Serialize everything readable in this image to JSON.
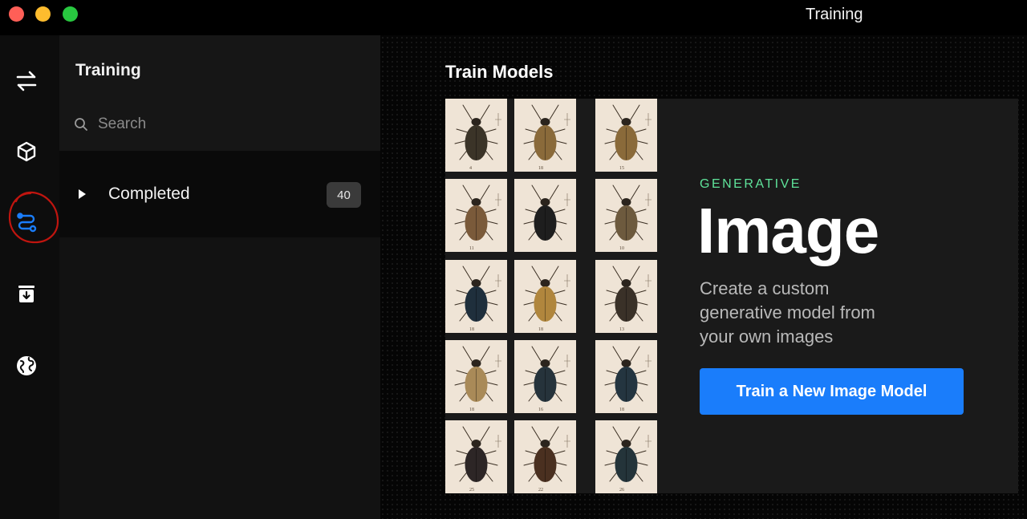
{
  "window": {
    "title": "Training"
  },
  "rail": {
    "items": [
      {
        "name": "swap-icon"
      },
      {
        "name": "cube-icon"
      },
      {
        "name": "workflow-icon",
        "active": true
      },
      {
        "name": "download-box-icon"
      },
      {
        "name": "globe-icon"
      }
    ],
    "accent": "#1a7dfb",
    "annotation_color": "#c0150f"
  },
  "sidebar": {
    "title": "Training",
    "search": {
      "placeholder": "Search",
      "value": ""
    },
    "groups": [
      {
        "label": "Completed",
        "count": "40",
        "expanded": false
      }
    ]
  },
  "main": {
    "title": "Train Models",
    "card": {
      "eyebrow": "GENERATIVE",
      "headline": "Image",
      "description": "Create a custom generative model from your own images",
      "button_label": "Train a New Image Model",
      "button_color": "#1a7dfb",
      "eyebrow_color": "#5fe39a"
    },
    "gallery": {
      "rows": 5,
      "cols": 3,
      "beetles": [
        {
          "color": "#3b3428",
          "label": "4"
        },
        {
          "color": "#8a6a3a",
          "label": "18"
        },
        {
          "color": "#8a6a3a",
          "label": "15"
        },
        {
          "color": "#7a5a3a",
          "label": "11"
        },
        {
          "color": "#1e1e1e",
          "label": ""
        },
        {
          "color": "#6d5a3e",
          "label": "10"
        },
        {
          "color": "#1f2f3c",
          "label": "18"
        },
        {
          "color": "#b0863d",
          "label": "18"
        },
        {
          "color": "#3a3128",
          "label": "13"
        },
        {
          "color": "#a98a58",
          "label": "18"
        },
        {
          "color": "#26333b",
          "label": "16"
        },
        {
          "color": "#243540",
          "label": "18"
        },
        {
          "color": "#2d2626",
          "label": "25"
        },
        {
          "color": "#4a3020",
          "label": "22"
        },
        {
          "color": "#24343a",
          "label": "26"
        }
      ]
    }
  }
}
